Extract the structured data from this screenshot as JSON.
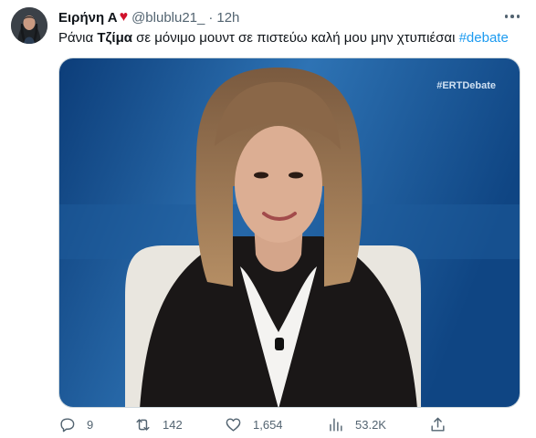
{
  "author": {
    "name": "Ειρήνη Α",
    "emoji": "♥",
    "handle": "@blublu21_",
    "separator": "·",
    "time": "12h"
  },
  "tweet": {
    "text_before": "Ράνια ",
    "text_bold": "Τζίμα",
    "text_after": " σε μόνιμο μουντ σε πιστεύω καλή μου μην χτυπιέσαι ",
    "hashtag": "#debate"
  },
  "media": {
    "watermark": "#ERTDebate",
    "description_icon": "tv-debate-photo"
  },
  "actions": {
    "replies": "9",
    "retweets": "142",
    "likes": "1,654",
    "views": "53.2K"
  },
  "colors": {
    "accent": "#1d9bf0",
    "secondary_text": "#536471",
    "heart": "#d0122b"
  }
}
